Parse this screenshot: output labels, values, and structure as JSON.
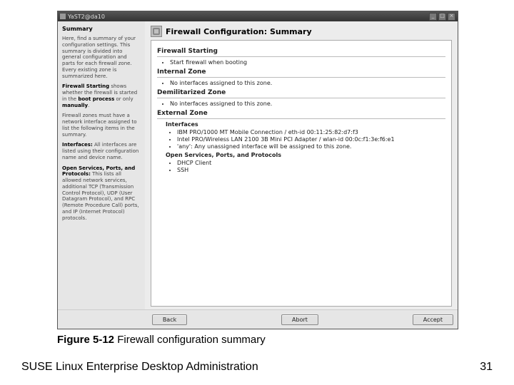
{
  "window": {
    "title": "YaST2@da10",
    "controls": {
      "min": "_",
      "max": "□",
      "close": "×"
    }
  },
  "help": {
    "heading": "Summary",
    "p1_before": "Here, find a summary of your configuration settings. This summary is divided into general configuration and parts for each firewall zone. Every existing zone is summarized here.",
    "p2_bold": "Firewall Starting",
    "p2_mid": " shows whether the firewall is started in the ",
    "p2_bold2": "boot process",
    "p2_mid2": " or only ",
    "p2_bold3": "manually",
    "p2_end": ".",
    "p3": "Firewall zones must have a network interface assigned to list the following items in the summary.",
    "p4_bold": "Interfaces:",
    "p4_rest": " All interfaces are listed using their configuration name and device name.",
    "p5_bold": "Open Services, Ports, and Protocols:",
    "p5_rest": " This lists all allowed network services, additional TCP (Transmission Control Protocol), UDP (User Datagram Protocol), and RPC (Remote Procedure Call) ports, and IP (Internet Protocol) protocols."
  },
  "main": {
    "title": "Firewall Configuration: Summary",
    "sections": {
      "starting": {
        "title": "Firewall Starting",
        "items": [
          "Start firewall when booting"
        ]
      },
      "internal": {
        "title": "Internal Zone",
        "items": [
          "No interfaces assigned to this zone."
        ]
      },
      "dmz": {
        "title": "Demilitarized Zone",
        "items": [
          "No interfaces assigned to this zone."
        ]
      },
      "external": {
        "title": "External Zone",
        "interfaces_label": "Interfaces",
        "interfaces": [
          "IBM PRO/1000 MT Mobile Connection / eth-id 00:11:25:82:d7:f3",
          "Intel PRO/Wireless LAN 2100 3B Mini PCI Adapter / wlan-id 00:0c:f1:3e:f6:e1",
          "'any': Any unassigned interface will be assigned to this zone."
        ],
        "services_label": "Open Services, Ports, and Protocols",
        "services": [
          "DHCP Client",
          "SSH"
        ]
      }
    }
  },
  "buttons": {
    "back": "Back",
    "abort": "Abort",
    "accept": "Accept"
  },
  "caption_bold": "Figure 5-12",
  "caption_rest": " Firewall configuration summary",
  "footer": "SUSE Linux Enterprise Desktop Administration",
  "page": "31"
}
